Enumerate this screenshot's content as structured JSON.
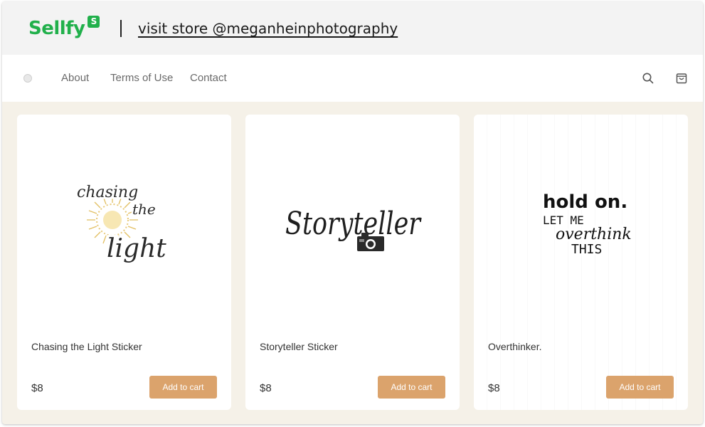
{
  "sellfy_bar": {
    "brand_name": "Sellfy",
    "brand_badge": "S",
    "visit_store_link": "visit store @meganheinphotography",
    "brand_color": "#21b04b"
  },
  "store_nav": {
    "links": [
      "About",
      "Terms of Use",
      "Contact"
    ],
    "icons": [
      "search-icon",
      "shopping-bag-icon"
    ]
  },
  "products": [
    {
      "title": "Chasing the Light Sticker",
      "price": "$8",
      "button_label": "Add to cart",
      "art_text": [
        "chasing",
        "the",
        "light"
      ]
    },
    {
      "title": "Storyteller Sticker",
      "price": "$8",
      "button_label": "Add to cart",
      "art_text": [
        "Storyteller"
      ]
    },
    {
      "title": "Overthinker.",
      "price": "$8",
      "button_label": "Add to cart",
      "art_text": [
        "hold on.",
        "LET ME",
        "overthink",
        "THIS"
      ]
    }
  ],
  "colors": {
    "page_background": "#f5f1e8",
    "button": "#dba36c"
  }
}
